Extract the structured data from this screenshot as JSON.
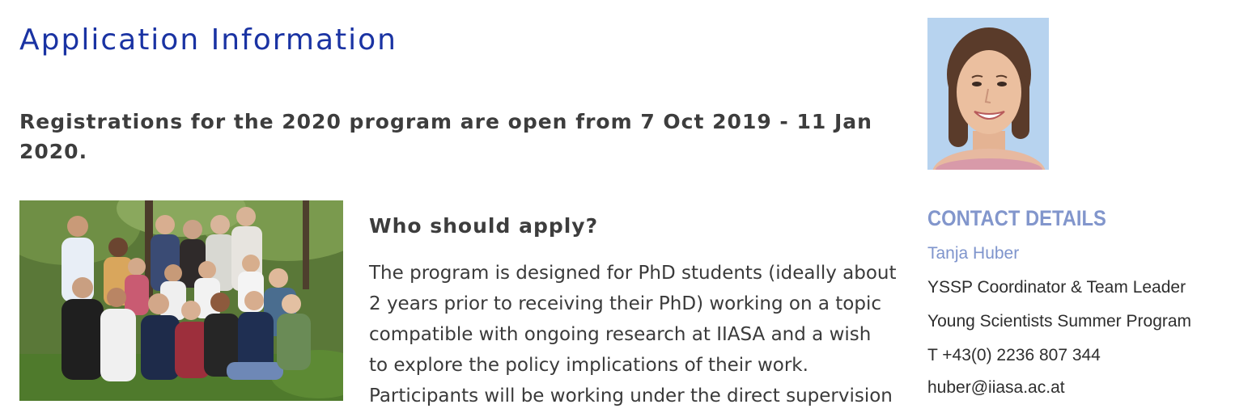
{
  "page": {
    "title": "Application Information",
    "registration_notice": "Registrations for the 2020 program are open from 7 Oct 2019 - 11 Jan 2020."
  },
  "who_should_apply": {
    "heading": "Who should apply?",
    "body_lines": [
      "The program is designed for PhD students (ideally about",
      "2 years prior to receiving their PhD) working on a topic",
      "compatible with ongoing research at IIASA and a wish",
      "to explore the policy implications of their work.",
      "Participants will be working under the direct supervision"
    ]
  },
  "contact": {
    "heading": "CONTACT DETAILS",
    "name": "Tanja Huber",
    "role": "YSSP Coordinator & Team Leader",
    "program": "Young Scientists Summer Program",
    "phone": "T +43(0) 2236 807 344",
    "email": "huber@iiasa.ac.at"
  },
  "colors": {
    "title": "#1a33a3",
    "contact_accent": "#8296cc",
    "body_text": "#3a3a3a"
  }
}
